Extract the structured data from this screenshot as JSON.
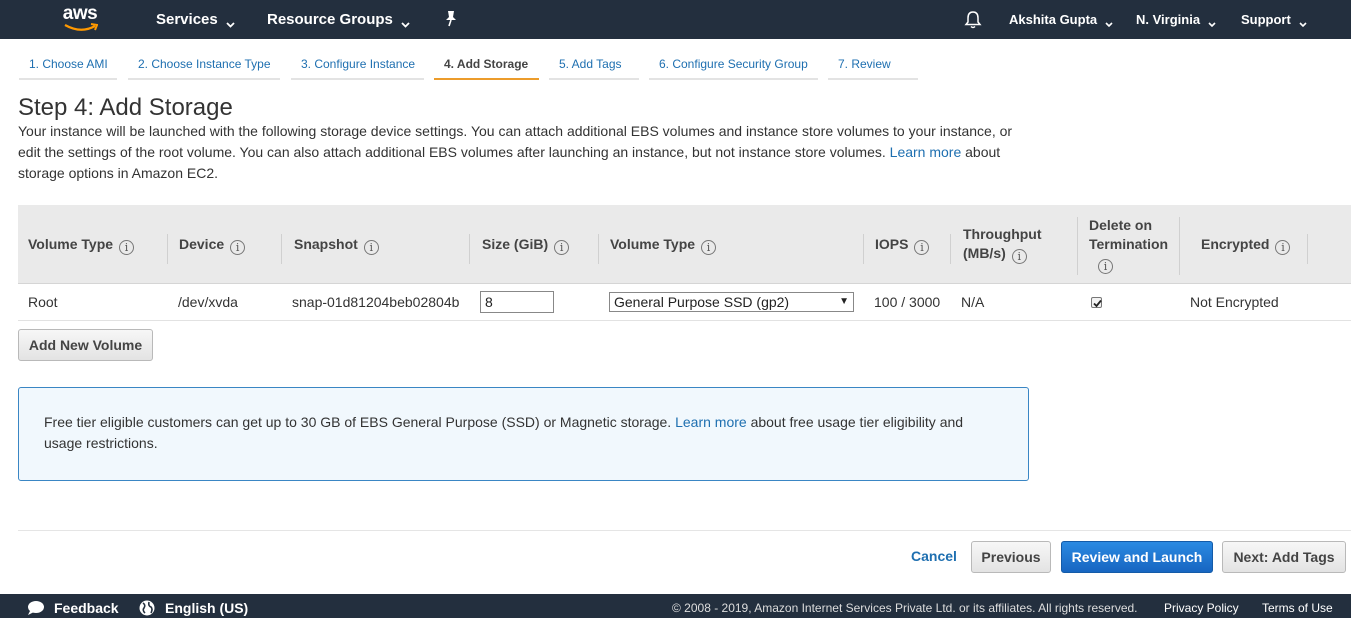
{
  "nav": {
    "logo_text": "aws",
    "services": "Services",
    "resource_groups": "Resource Groups",
    "user": "Akshita Gupta",
    "region": "N. Virginia",
    "support": "Support"
  },
  "wizard": {
    "tabs": [
      {
        "label": "1. Choose AMI"
      },
      {
        "label": "2. Choose Instance Type"
      },
      {
        "label": "3. Configure Instance"
      },
      {
        "label": "4. Add Storage"
      },
      {
        "label": "5. Add Tags"
      },
      {
        "label": "6. Configure Security Group"
      },
      {
        "label": "7. Review"
      }
    ],
    "active_tab": "4. Add Storage"
  },
  "page": {
    "title": "Step 4: Add Storage",
    "intro_before_link": "Your instance will be launched with the following storage device settings. You can attach additional EBS volumes and instance store volumes to your instance, or edit the settings of the root volume. You can also attach additional EBS volumes after launching an instance, but not instance store volumes.",
    "intro_link": "Learn more",
    "intro_after_link": "about storage options in Amazon EC2."
  },
  "table": {
    "headers": {
      "volume_type": "Volume Type",
      "device": "Device",
      "snapshot": "Snapshot",
      "size": "Size (GiB)",
      "volume_type2": "Volume Type",
      "iops": "IOPS",
      "throughput_line1": "Throughput",
      "throughput_line2": "(MB/s)",
      "delete_line1": "Delete on",
      "delete_line2": "Termination",
      "encrypted": "Encrypted"
    },
    "row": {
      "volume_type": "Root",
      "device": "/dev/xvda",
      "snapshot": "snap-01d81204beb02804b",
      "size": "8",
      "ebs_type": "General Purpose SSD (gp2)",
      "iops": "100 / 3000",
      "throughput": "N/A",
      "delete_on_termination": true,
      "encrypted": "Not Encrypted"
    }
  },
  "buttons": {
    "add_volume": "Add New Volume",
    "cancel": "Cancel",
    "previous": "Previous",
    "review_launch": "Review and Launch",
    "next": "Next: Add Tags"
  },
  "infobox": {
    "before_link": "Free tier eligible customers can get up to 30 GB of EBS General Purpose (SSD) or Magnetic storage.",
    "link": "Learn more",
    "after_link": "about free usage tier eligibility and usage restrictions."
  },
  "footer": {
    "feedback": "Feedback",
    "language": "English (US)",
    "copyright": "© 2008 - 2019, Amazon Internet Services Private Ltd. or its affiliates. All rights reserved.",
    "privacy": "Privacy Policy",
    "terms": "Terms of Use"
  },
  "colors": {
    "nav_bg": "#232f3e",
    "link": "#1e6fb0",
    "active_tab_underline": "#ec9c2b",
    "primary_button": "#1765c1",
    "info_border": "#3a86c4"
  }
}
